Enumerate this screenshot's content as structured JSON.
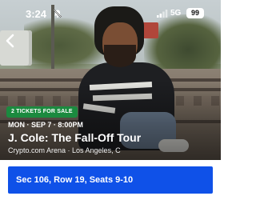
{
  "status_bar": {
    "time": "3:24",
    "network": "5G",
    "battery": "99"
  },
  "event": {
    "badge": "2 TICKETS FOR SALE",
    "date": "MON · SEP 7 · 8:00PM",
    "title": "J. Cole: The Fall-Off Tour",
    "venue": "Crypto.com Arena · Los Angeles, C"
  },
  "ticket": {
    "seats": "Sec 106, Row 19, Seats 9-10"
  },
  "colors": {
    "badge": "#1b8a3f",
    "seats_bar": "#0f51e8"
  },
  "icons": [
    "back-arrow-icon",
    "bell-slash-icon",
    "signal-bars-icon",
    "wifi-icon",
    "battery-icon"
  ]
}
